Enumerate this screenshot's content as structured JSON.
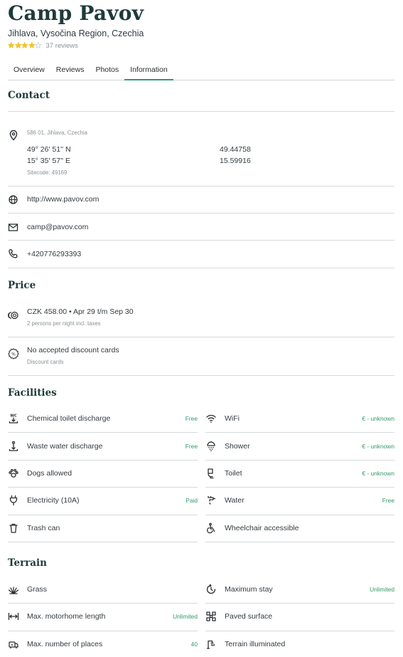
{
  "header": {
    "title": "Camp Pavov",
    "location": "Jihlava, Vysočina Region, Czechia",
    "stars": 4,
    "reviews": "37 reviews"
  },
  "tabs": [
    "Overview",
    "Reviews",
    "Photos",
    "Information"
  ],
  "active_tab": "Information",
  "contact": {
    "title": "Contact",
    "address": "586 01, Jihlava, Czechia",
    "lat_dms": "49° 26' 51'' N",
    "lon_dms": "15° 35' 57'' E",
    "lat_dec": "49.44758",
    "lon_dec": "15.59916",
    "sitecode": "Sitecode: 49169",
    "website": "http://www.pavov.com",
    "email": "camp@pavov.com",
    "phone": "+420776293393"
  },
  "price": {
    "title": "Price",
    "main": "CZK 458.00 • Apr 29 t/m Sep 30",
    "main_sub": "2 persons per night incl. taxes",
    "discount": "No accepted discount cards",
    "discount_sub": "Discount cards"
  },
  "facilities": {
    "title": "Facilities",
    "left": [
      {
        "label": "Chemical toilet discharge",
        "value": "Free",
        "icon": "chemical-toilet-icon"
      },
      {
        "label": "Waste water discharge",
        "value": "Free",
        "icon": "waste-water-icon"
      },
      {
        "label": "Dogs allowed",
        "value": "",
        "icon": "paw-icon"
      },
      {
        "label": "Electricity (10A)",
        "value": "Paid",
        "icon": "plug-icon"
      },
      {
        "label": "Trash can",
        "value": "",
        "icon": "trash-icon"
      }
    ],
    "right": [
      {
        "label": "WiFi",
        "value": "€ - unknown",
        "icon": "wifi-icon"
      },
      {
        "label": "Shower",
        "value": "€ - unknown",
        "icon": "shower-icon"
      },
      {
        "label": "Toilet",
        "value": "€ - unknown",
        "icon": "toilet-icon"
      },
      {
        "label": "Water",
        "value": "Free",
        "icon": "water-tap-icon"
      },
      {
        "label": "Wheelchair accessible",
        "value": "",
        "icon": "wheelchair-icon"
      }
    ]
  },
  "terrain": {
    "title": "Terrain",
    "left": [
      {
        "label": "Grass",
        "value": "",
        "icon": "grass-icon"
      },
      {
        "label": "Max. motorhome length",
        "value": "Unlimited",
        "icon": "length-icon"
      },
      {
        "label": "Max. number of places",
        "value": "40",
        "icon": "places-icon"
      }
    ],
    "right": [
      {
        "label": "Maximum stay",
        "value": "Unlimited",
        "icon": "max-stay-icon"
      },
      {
        "label": "Paved surface",
        "value": "",
        "icon": "paved-surface-icon"
      },
      {
        "label": "Terrain illuminated",
        "value": "",
        "icon": "terrain-illuminated-icon"
      }
    ]
  },
  "colors": {
    "accent": "#2a9a74",
    "heading": "#1f3a3a",
    "value_green": "#2f9a63",
    "star": "#f2c230"
  }
}
